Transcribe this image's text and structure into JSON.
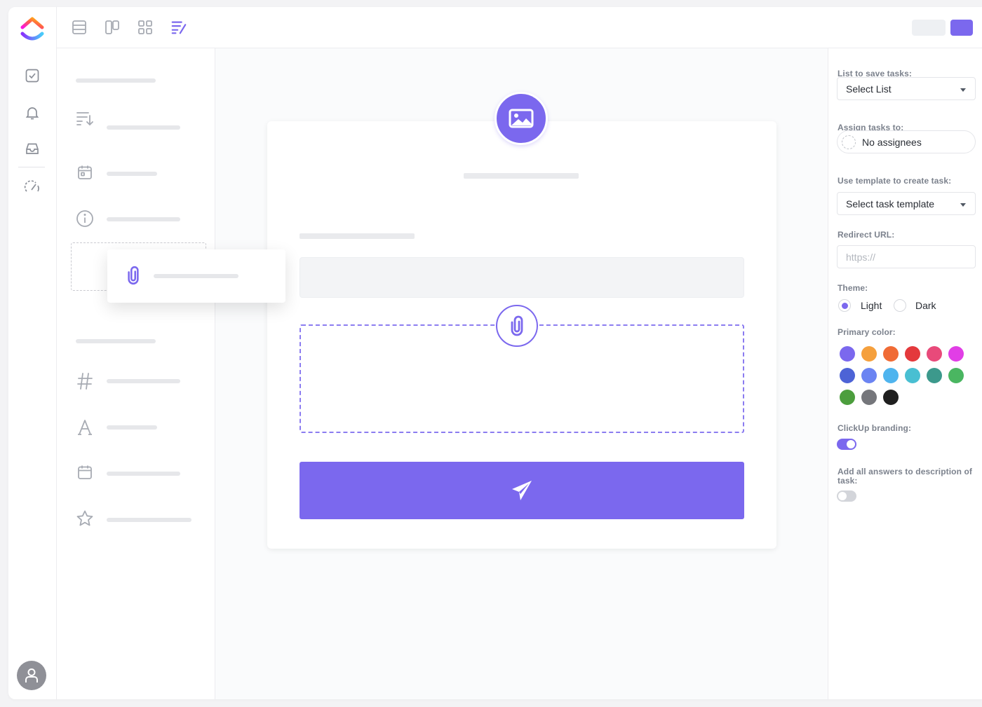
{
  "settings": {
    "list_label": "List to save tasks:",
    "list_value": "Select List",
    "assign_label": "Assign tasks to:",
    "assign_value": "No assignees",
    "template_label": "Use template to create task:",
    "template_value": "Select task template",
    "redirect_label": "Redirect URL:",
    "redirect_placeholder": "https://",
    "theme_label": "Theme:",
    "theme_options": [
      "Light",
      "Dark"
    ],
    "theme_selected": "Light",
    "primary_label": "Primary color:",
    "colors": [
      "#7b68ee",
      "#f5a03d",
      "#f06b35",
      "#e4393c",
      "#e84a7a",
      "#e13ee6",
      "#4d63d6",
      "#6b84f2",
      "#4fb4ee",
      "#49bfd2",
      "#3c998c",
      "#4ab661",
      "#4c9e3d",
      "#75767b",
      "#1f1f1f"
    ],
    "branding_label": "ClickUp branding:",
    "branding_on": true,
    "answers_label": "Add all answers to description of task:",
    "answers_on": false
  },
  "theme": {
    "accent": "#7b68ee"
  }
}
